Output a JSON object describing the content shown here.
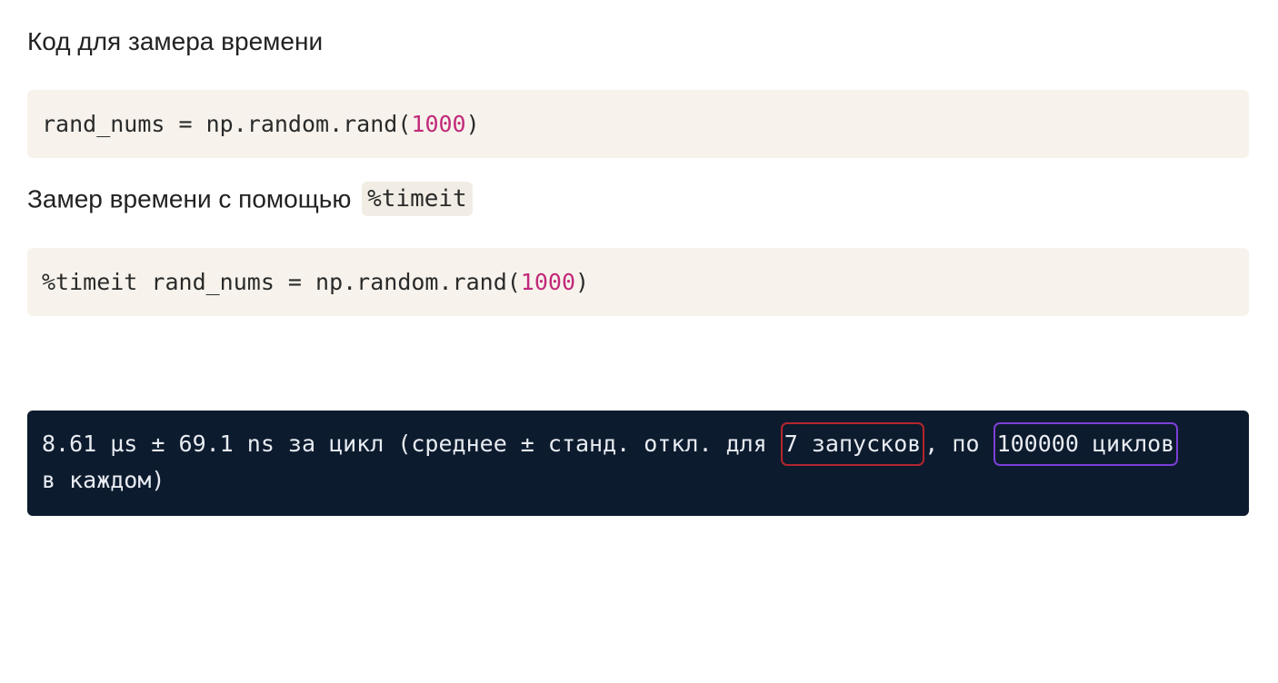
{
  "section1": {
    "heading": "Код для замера времени",
    "code": {
      "prefix": "rand_nums = np.random.rand(",
      "number": "1000",
      "suffix": ")"
    }
  },
  "section2": {
    "heading": "Замер времени с помощью",
    "inline_code": "%timeit",
    "code": {
      "prefix": "%timeit rand_nums = np.random.rand(",
      "number": "1000",
      "suffix": ")"
    }
  },
  "output": {
    "part1": "8.61 µs ± 69.1 ns за цикл (среднее ± станд. откл. для ",
    "runs_highlight": "7 запусков",
    "part2": ", по ",
    "loops_highlight": "100000 циклов",
    "line2": "в каждом)"
  },
  "colors": {
    "code_background": "#f7f3ec",
    "number_literal": "#c2297a",
    "output_background": "#0d1b2e",
    "runs_box": "#b3262e",
    "loops_box": "#7b3fd6"
  }
}
